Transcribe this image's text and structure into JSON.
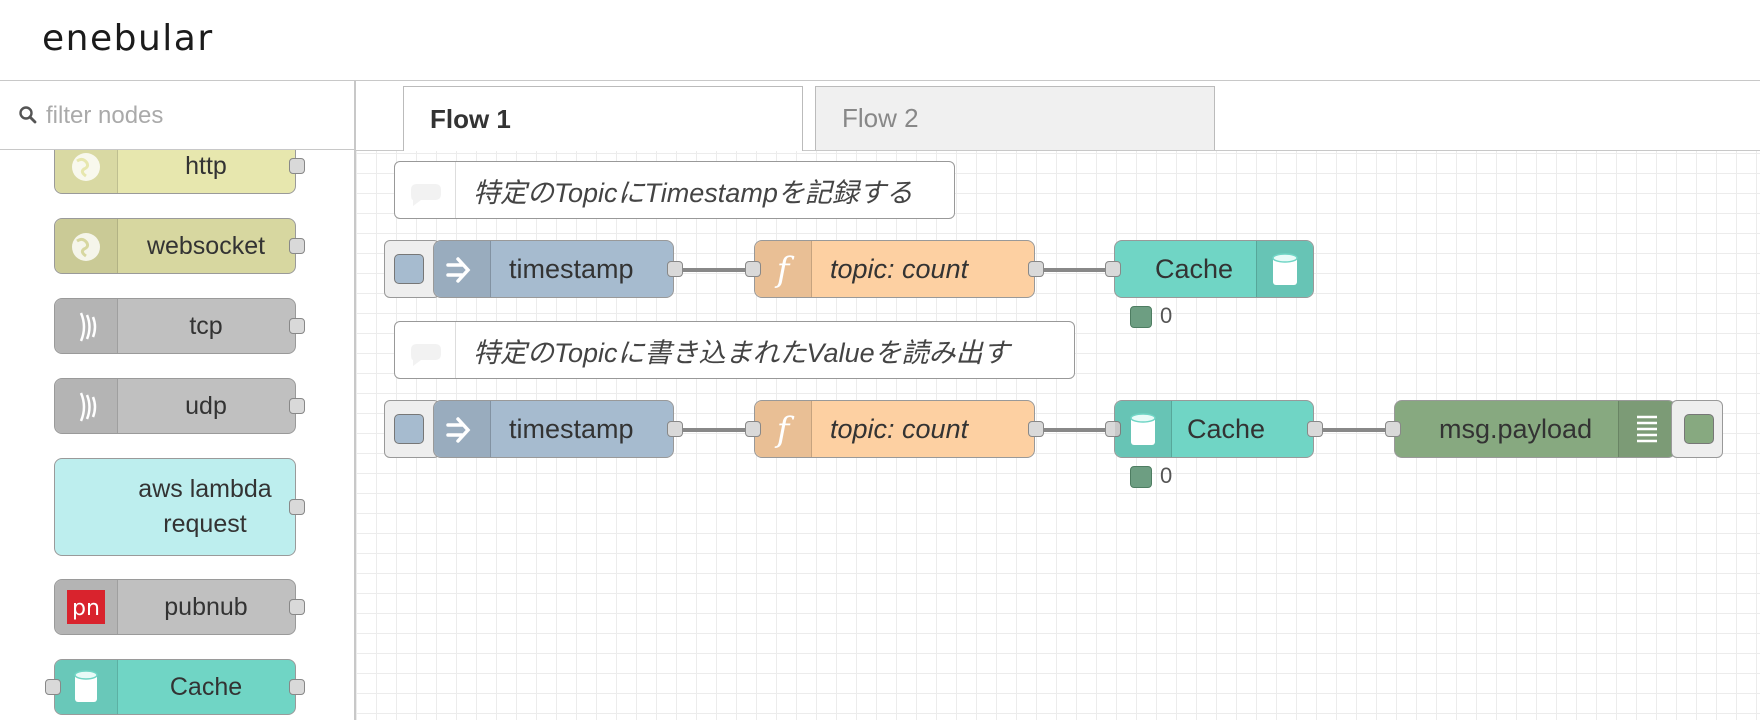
{
  "header": {
    "logo": "enebular"
  },
  "palette": {
    "filter_placeholder": "filter nodes",
    "nodes": [
      {
        "label": "http",
        "color": "#e7e7ae",
        "icon": "globe-icon"
      },
      {
        "label": "websocket",
        "color": "#d7d7a0",
        "icon": "globe-icon"
      },
      {
        "label": "tcp",
        "color": "#c0c0c0",
        "icon": "bridge-icon"
      },
      {
        "label": "udp",
        "color": "#c0c0c0",
        "icon": "bridge-icon"
      },
      {
        "label": "aws lambda request",
        "color": "#bdeeee",
        "icon": ""
      },
      {
        "label": "pubnub",
        "color": "#c0c0c0",
        "icon": "pubnub-logo"
      },
      {
        "label": "Cache",
        "color": "#70d5c5",
        "icon": "database-icon"
      }
    ]
  },
  "tabs": [
    {
      "label": "Flow 1",
      "active": true
    },
    {
      "label": "Flow 2",
      "active": false
    }
  ],
  "flow": {
    "comment1": "特定のTopicにTimestampを記録する",
    "comment2": "特定のTopicに書き込まれたValueを読み出す",
    "row1": {
      "inject": "timestamp",
      "function": "topic: count",
      "cache": "Cache",
      "status": "0"
    },
    "row2": {
      "inject": "timestamp",
      "function": "topic: count",
      "cache": "Cache",
      "status": "0",
      "debug": "msg.payload"
    }
  },
  "colors": {
    "inject": "#a6bbcf",
    "function": "#fdd0a2",
    "cache": "#70d5c5",
    "debug": "#87a980"
  }
}
